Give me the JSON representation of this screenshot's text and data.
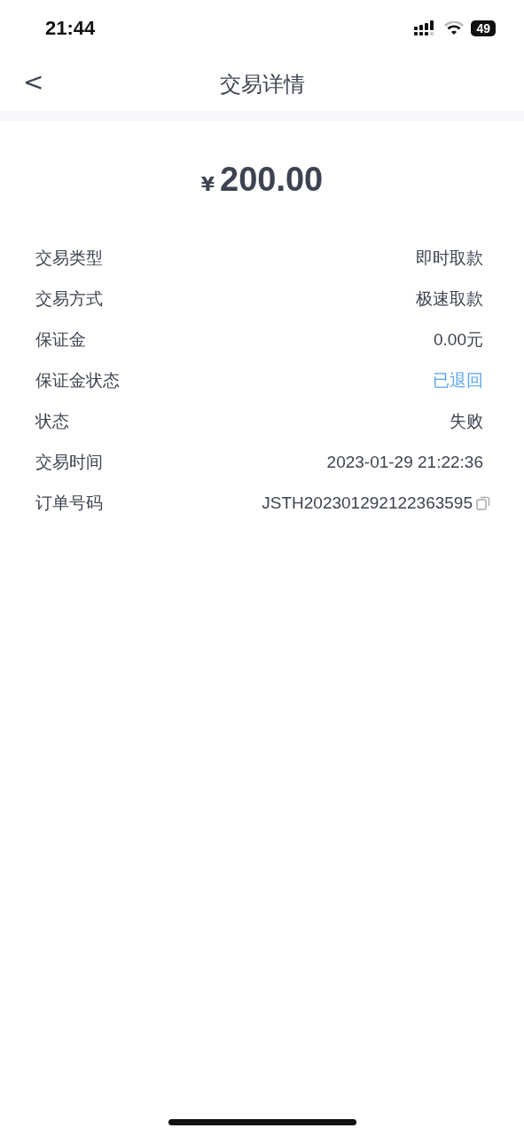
{
  "status_bar": {
    "time": "21:44",
    "battery": "49"
  },
  "nav": {
    "back": "<",
    "title": "交易详情"
  },
  "amount": {
    "currency": "¥",
    "value": "200.00"
  },
  "rows": [
    {
      "label": "交易类型",
      "value": "即时取款",
      "kind": "plain"
    },
    {
      "label": "交易方式",
      "value": "极速取款",
      "kind": "plain"
    },
    {
      "label": "保证金",
      "value": "0.00元",
      "kind": "plain"
    },
    {
      "label": "保证金状态",
      "value": "已退回",
      "kind": "link"
    },
    {
      "label": "状态",
      "value": "失败",
      "kind": "plain"
    },
    {
      "label": "交易时间",
      "value": "2023-01-29 21:22:36",
      "kind": "plain"
    },
    {
      "label": "订单号码",
      "value": "JSTH202301292122363595",
      "kind": "copy"
    }
  ]
}
